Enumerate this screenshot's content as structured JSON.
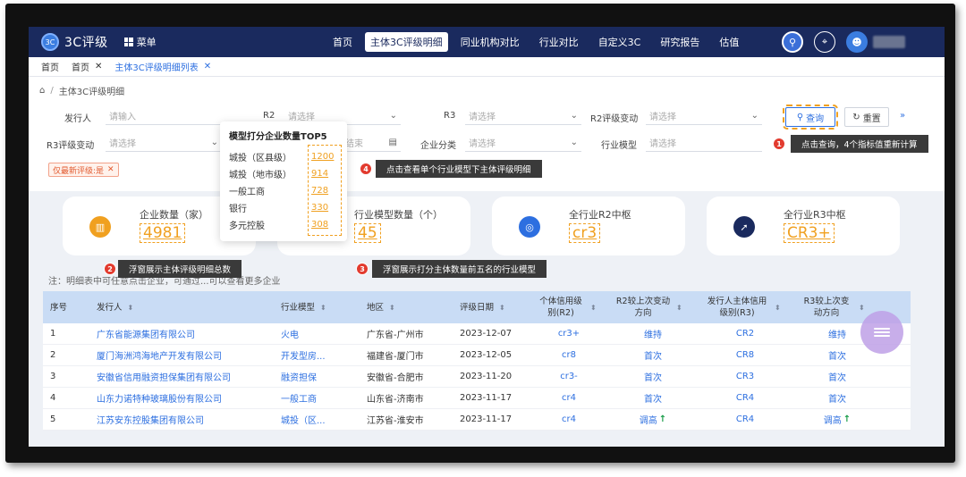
{
  "app": {
    "logo_text": "3C评级",
    "logo_mark": "3C",
    "menu_label": "菜单"
  },
  "nav": {
    "items": [
      "首页",
      "主体3C评级明细",
      "同业机构对比",
      "行业对比",
      "自定义3C",
      "研究报告",
      "估值"
    ],
    "active_index": 1
  },
  "tabs": [
    {
      "label": "首页",
      "closable": false
    },
    {
      "label": "首页",
      "closable": true
    },
    {
      "label": "主体3C评级明细列表",
      "closable": true
    }
  ],
  "breadcrumb": [
    "主体3C评级明细"
  ],
  "filters": {
    "issuer": {
      "label": "发行人",
      "placeholder": "请输入"
    },
    "r2": {
      "label": "R2",
      "placeholder": "请选择"
    },
    "r3": {
      "label": "R3",
      "placeholder": "请选择"
    },
    "r2_change": {
      "label": "R2评级变动",
      "placeholder": "请选择"
    },
    "r3_change": {
      "label": "R3评级变动",
      "placeholder": "请选择"
    },
    "date_end": {
      "placeholder": "结束"
    },
    "company_type": {
      "label": "企业分类",
      "placeholder": "请选择"
    },
    "industry_model": {
      "label": "行业模型",
      "placeholder": "请选择"
    },
    "query_label": "查询",
    "reset_label": "重置",
    "active_tag": "仅最新评级:是"
  },
  "cards": [
    {
      "label": "企业数量（家）",
      "value": "4981",
      "icon": "building-icon",
      "color": "#f0a020"
    },
    {
      "label": "行业模型数量（个）",
      "value": "45",
      "icon": "model-icon",
      "color": "#2d6fe0"
    },
    {
      "label": "全行业R2中枢",
      "value": "cr3",
      "icon": "target-icon",
      "color": "#2d6fe0"
    },
    {
      "label": "全行业R3中枢",
      "value": "CR3+",
      "icon": "compass-icon",
      "color": "#1a2a5e"
    }
  ],
  "popup": {
    "title": "模型打分企业数量TOP5",
    "rows": [
      {
        "name": "城投（区县级）",
        "count": "1200"
      },
      {
        "name": "城投（地市级）",
        "count": "914"
      },
      {
        "name": "一般工商",
        "count": "728"
      },
      {
        "name": "银行",
        "count": "330"
      },
      {
        "name": "多元控股",
        "count": "308"
      }
    ]
  },
  "note": "注：明细表中可任意点击企业，可通过...可以查看更多企业",
  "annotations": {
    "a1": {
      "num": "1",
      "text": "点击查询，4个指标值重新计算"
    },
    "a2": {
      "num": "2",
      "text": "浮窗展示主体评级明细总数"
    },
    "a3": {
      "num": "3",
      "text": "浮窗展示打分主体数量前五名的行业模型"
    },
    "a4": {
      "num": "4",
      "text": "点击查看单个行业模型下主体评级明细"
    }
  },
  "table": {
    "headers": [
      "序号",
      "发行人",
      "行业模型",
      "地区",
      "评级日期",
      "个体信用级别(R2)",
      "R2较上次变动方向",
      "发行人主体信用级别(R3)",
      "R3较上次变动方向"
    ],
    "rows": [
      {
        "idx": "1",
        "issuer": "广东省能源集团有限公司",
        "model": "火电",
        "region": "广东省-广州市",
        "date": "2023-12-07",
        "r2": "cr3+",
        "r2_change": "维持",
        "r3": "CR2",
        "r3_change": "维持",
        "r2_up": false,
        "r3_up": false
      },
      {
        "idx": "2",
        "issuer": "厦门海洲鸿海地产开发有限公司",
        "model": "开发型房...",
        "region": "福建省-厦门市",
        "date": "2023-12-05",
        "r2": "cr8",
        "r2_change": "首次",
        "r3": "CR8",
        "r3_change": "首次",
        "r2_up": false,
        "r3_up": false
      },
      {
        "idx": "3",
        "issuer": "安徽省信用融资担保集团有限公司",
        "model": "融资担保",
        "region": "安徽省-合肥市",
        "date": "2023-11-20",
        "r2": "cr3-",
        "r2_change": "首次",
        "r3": "CR3",
        "r3_change": "首次",
        "r2_up": false,
        "r3_up": false
      },
      {
        "idx": "4",
        "issuer": "山东力诺特种玻璃股份有限公司",
        "model": "一般工商",
        "region": "山东省-济南市",
        "date": "2023-11-17",
        "r2": "cr4",
        "r2_change": "首次",
        "r3": "CR4",
        "r3_change": "首次",
        "r2_up": false,
        "r3_up": false
      },
      {
        "idx": "5",
        "issuer": "江苏安东控股集团有限公司",
        "model": "城投（区...",
        "region": "江苏省-淮安市",
        "date": "2023-11-17",
        "r2": "cr4",
        "r2_change": "调高",
        "r3": "CR4",
        "r3_change": "调高",
        "r2_up": true,
        "r3_up": true
      }
    ]
  }
}
